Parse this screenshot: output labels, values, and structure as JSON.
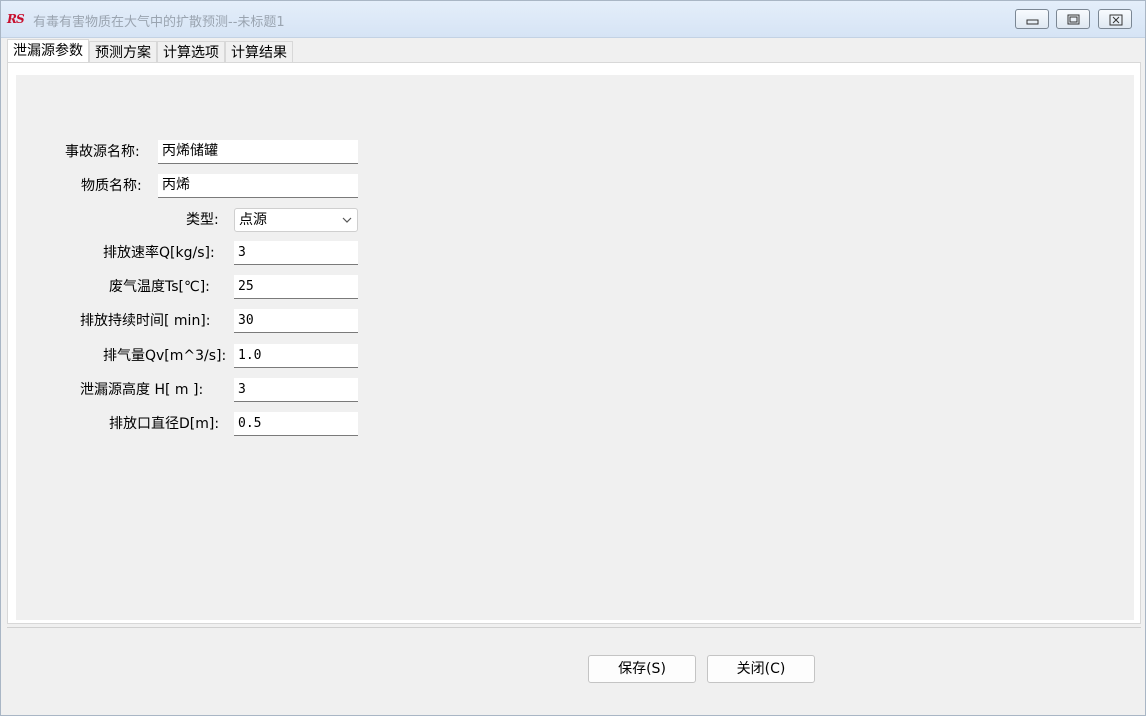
{
  "window": {
    "logo_text": "RS",
    "title": "有毒有害物质在大气中的扩散预测--未标题1"
  },
  "tabs": [
    {
      "label": "泄漏源参数",
      "active": true
    },
    {
      "label": "预测方案",
      "active": false
    },
    {
      "label": "计算选项",
      "active": false
    },
    {
      "label": "计算结果",
      "active": false
    }
  ],
  "form": {
    "source_name": {
      "label": "事故源名称:",
      "value": "丙烯储罐"
    },
    "substance_name": {
      "label": "物质名称:",
      "value": "丙烯"
    },
    "type": {
      "label": "类型:",
      "value": "点源"
    },
    "emission_rate": {
      "label": "排放速率Q[kg/s]:",
      "value": "3"
    },
    "gas_temperature": {
      "label": "废气温度Ts[℃]:",
      "value": "25"
    },
    "duration": {
      "label": "排放持续时间[ min]:",
      "value": "30"
    },
    "gas_volume": {
      "label": "排气量Qv[m^3/s]:",
      "value": "1.0"
    },
    "source_height": {
      "label": "泄漏源高度 H[  m ]:",
      "value": "3"
    },
    "outlet_diameter": {
      "label": "排放口直径D[m]:",
      "value": "0.5"
    }
  },
  "buttons": {
    "save": "保存(S)",
    "close": "关闭(C)"
  },
  "icons": {
    "minimize": "minimize-icon",
    "maximize": "maximize-icon",
    "close": "close-icon",
    "dropdown": "chevron-down-icon"
  },
  "colors": {
    "title_text": "#9aa4b0",
    "logo": "#c8102e",
    "titlebar": "#d6e4f5",
    "background": "#f0f0f0"
  }
}
